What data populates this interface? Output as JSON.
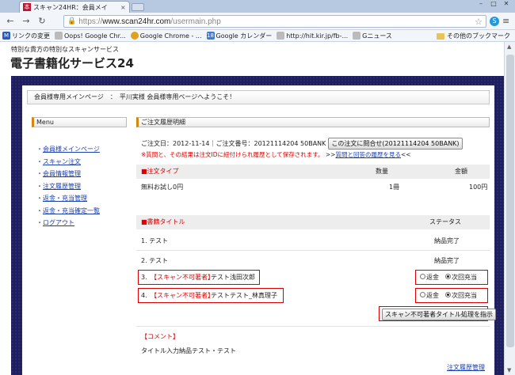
{
  "browser": {
    "tab_title": "スキャン24HR：会員メイ",
    "tab_close": "×",
    "url_proto": "https://",
    "url_host": "www.scan24hr.com",
    "url_path": "/usermain.php",
    "bookmarks": [
      {
        "label": "リンクの変更",
        "icon": "M",
        "color": "#2a5bb8"
      },
      {
        "label": "Oops! Google Chr...",
        "icon": "",
        "color": "#bbbbbb"
      },
      {
        "label": "Google Chrome - ...",
        "icon": "",
        "color": "#e0a020"
      },
      {
        "label": "Google カレンダー",
        "icon": "18",
        "color": "#3a7ad8"
      },
      {
        "label": "http://hit.kir.jp/fb-...",
        "icon": "",
        "color": "#bbbbbb"
      },
      {
        "label": "Gニュース",
        "icon": "",
        "color": "#bbbbbb"
      }
    ],
    "other_bookmarks": "その他のブックマーク"
  },
  "header": {
    "tagline": "特別な貴方の特別なスキャンサービス",
    "logo": "電子書籍化サービス24"
  },
  "welcome": "会員様専用メインページ　：　平川実様 会員様専用ページへようこそ！",
  "menu": {
    "title": "Menu",
    "items": [
      "会員様メインページ",
      "スキャン注文",
      "会員情報管理",
      "注文履歴管理",
      "返金・充当管理",
      "返金・充当確定一覧",
      "ログアウト"
    ]
  },
  "order": {
    "section_title": "ご注文履歴明細",
    "info": "ご注文日：2012-11-14｜ご注文番号：20121114204 50BANK",
    "inquiry_button": "この注文に問合せ(20121114204 50BANK)",
    "notice": "※質問と、その結果は注文IDに紐付けられ履歴として保存されます。",
    "history_link_prefix": ">>",
    "history_link": "質問と回答の履歴を見る",
    "history_link_suffix": "<<",
    "type_header": "■注文タイプ",
    "qty_header": "数量",
    "price_header": "金額",
    "type_value": "無料お試し0円",
    "qty_value": "1冊",
    "price_value": "100円",
    "books_header": "■書籍タイトル",
    "status_header": "ステータス",
    "books": [
      {
        "title": "1.  テスト",
        "prefix": "",
        "status": "納品完了"
      },
      {
        "title": "2.  テスト",
        "prefix": "",
        "status": "納品完了"
      },
      {
        "title": "テスト浅田次郎",
        "prefix": "【スキャン不可著者】",
        "num": "3.",
        "status": ""
      },
      {
        "title": "テストテスト_林真理子",
        "prefix": "【スキャン不可著者】",
        "num": "4.",
        "status": ""
      }
    ],
    "radio_refund": "返金",
    "radio_next": "次回充当",
    "process_button": "スキャン不可著者タイトル処理を指示",
    "comment_header": "【コメント】",
    "comment_text": "タイトル入力納品テスト・テスト",
    "footer_link": "注文履歴管理"
  }
}
